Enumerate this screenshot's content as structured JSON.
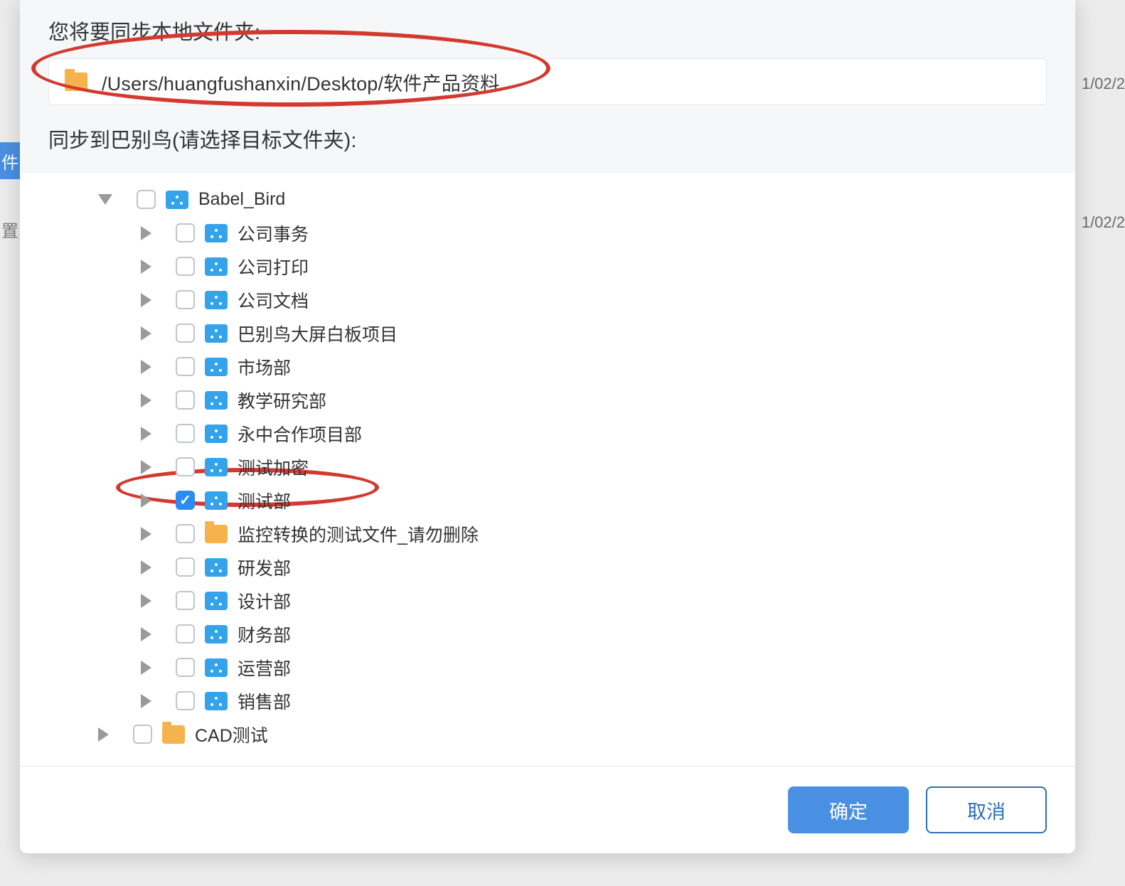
{
  "background": {
    "date_text_1": "1/02/2",
    "date_text_2": "1/02/2",
    "left_tab_char_1": "件",
    "left_tab_char_2": "置"
  },
  "dialog": {
    "local_label": "您将要同步本地文件夹:",
    "local_path": "/Users/huangfushanxin/Desktop/软件产品资料",
    "target_label": "同步到巴别鸟(请选择目标文件夹):",
    "confirm_label": "确定",
    "cancel_label": "取消"
  },
  "tree": [
    {
      "depth": 0,
      "expanded": true,
      "checked": false,
      "icon": "org",
      "label": "Babel_Bird"
    },
    {
      "depth": 1,
      "expanded": false,
      "checked": false,
      "icon": "org",
      "label": "公司事务"
    },
    {
      "depth": 1,
      "expanded": false,
      "checked": false,
      "icon": "org",
      "label": "公司打印"
    },
    {
      "depth": 1,
      "expanded": false,
      "checked": false,
      "icon": "org",
      "label": "公司文档"
    },
    {
      "depth": 1,
      "expanded": false,
      "checked": false,
      "icon": "org",
      "label": "巴别鸟大屏白板项目"
    },
    {
      "depth": 1,
      "expanded": false,
      "checked": false,
      "icon": "org",
      "label": "市场部"
    },
    {
      "depth": 1,
      "expanded": false,
      "checked": false,
      "icon": "org",
      "label": "教学研究部"
    },
    {
      "depth": 1,
      "expanded": false,
      "checked": false,
      "icon": "org",
      "label": "永中合作项目部"
    },
    {
      "depth": 1,
      "expanded": false,
      "checked": false,
      "icon": "org",
      "label": "测试加密"
    },
    {
      "depth": 1,
      "expanded": false,
      "checked": true,
      "icon": "org",
      "label": "测试部"
    },
    {
      "depth": 1,
      "expanded": false,
      "checked": false,
      "icon": "plain",
      "label": "监控转换的测试文件_请勿删除"
    },
    {
      "depth": 1,
      "expanded": false,
      "checked": false,
      "icon": "org",
      "label": "研发部"
    },
    {
      "depth": 1,
      "expanded": false,
      "checked": false,
      "icon": "org",
      "label": "设计部"
    },
    {
      "depth": 1,
      "expanded": false,
      "checked": false,
      "icon": "org",
      "label": "财务部"
    },
    {
      "depth": 1,
      "expanded": false,
      "checked": false,
      "icon": "org",
      "label": "运营部"
    },
    {
      "depth": 1,
      "expanded": false,
      "checked": false,
      "icon": "org",
      "label": "销售部"
    },
    {
      "depth": 0,
      "expanded": false,
      "checked": false,
      "icon": "plain",
      "label": "CAD测试"
    }
  ]
}
